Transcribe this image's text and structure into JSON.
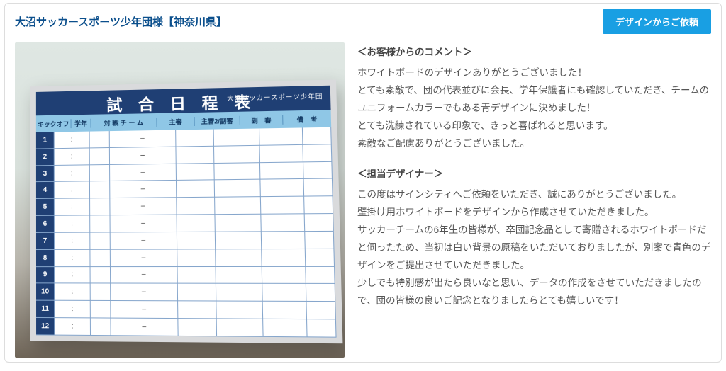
{
  "header": {
    "title": "大沼サッカースポーツ少年団様【神奈川県】",
    "cta": "デザインからご依頼"
  },
  "product_board": {
    "title": "試 合 日 程 表",
    "org": "大沼サッカースポーツ少年団",
    "columns": [
      "キックオフ",
      "学年",
      "対 戦 チ ー ム",
      "主審",
      "主審2/副審",
      "副　審",
      "備　考"
    ],
    "rows": [
      {
        "num": "1",
        "ko": ":",
        "team": "–"
      },
      {
        "num": "2",
        "ko": ":",
        "team": "–"
      },
      {
        "num": "3",
        "ko": ":",
        "team": "–"
      },
      {
        "num": "4",
        "ko": ":",
        "team": "–"
      },
      {
        "num": "5",
        "ko": ":",
        "team": "–"
      },
      {
        "num": "6",
        "ko": ":",
        "team": "–"
      },
      {
        "num": "7",
        "ko": ":",
        "team": "–"
      },
      {
        "num": "8",
        "ko": ":",
        "team": "–"
      },
      {
        "num": "9",
        "ko": ":",
        "team": "–"
      },
      {
        "num": "10",
        "ko": ":",
        "team": "–"
      },
      {
        "num": "11",
        "ko": ":",
        "team": "–"
      },
      {
        "num": "12",
        "ko": ":",
        "team": "–"
      }
    ]
  },
  "customer_comment": {
    "heading": "＜お客様からのコメント＞",
    "p1": "ホワイトボードのデザインありがとうございました！",
    "p2": "とても素敵で、団の代表並びに会長、学年保護者にも確認していただき、チームのユニフォームカラーでもある青デザインに決めました！",
    "p3": "とても洗練されている印象で、きっと喜ばれると思います。",
    "p4": "素敵なご配慮ありがとうございました。"
  },
  "designer_comment": {
    "heading": "＜担当デザイナー＞",
    "p1": "この度はサインシティへご依頼をいただき、誠にありがとうございました。",
    "p2": "壁掛け用ホワイトボードをデザインから作成させていただきました。",
    "p3": "サッカーチームの6年生の皆様が、卒団記念品として寄贈されるホワイトボードだと伺ったため、当初は白い背景の原稿をいただいておりましたが、別案で青色のデザインをご提出させていただきました。",
    "p4": "少しでも特別感が出たら良いなと思い、データの作成をさせていただきましたので、団の皆様の良いご記念となりましたらとても嬉しいです！"
  }
}
